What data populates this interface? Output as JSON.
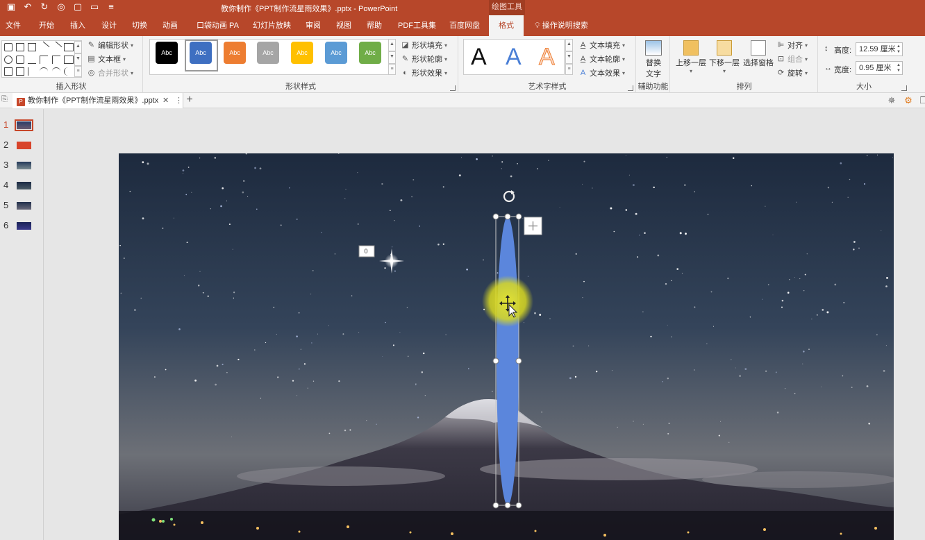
{
  "titlebar": {
    "title": "教你制作《PPT制作流星雨效果》.pptx  -  PowerPoint",
    "context_group": "绘图工具"
  },
  "tabs": [
    {
      "label": "文件"
    },
    {
      "label": "开始"
    },
    {
      "label": "插入"
    },
    {
      "label": "设计"
    },
    {
      "label": "切换"
    },
    {
      "label": "动画"
    },
    {
      "label": "口袋动画 PA"
    },
    {
      "label": "幻灯片放映"
    },
    {
      "label": "审阅"
    },
    {
      "label": "视图"
    },
    {
      "label": "帮助"
    },
    {
      "label": "PDF工具集"
    },
    {
      "label": "百度网盘"
    },
    {
      "label": "格式"
    }
  ],
  "tell_me": "操作说明搜索",
  "ribbon": {
    "insert_shapes": {
      "label": "插入形状",
      "edit_shape": "编辑形状",
      "text_box": "文本框",
      "merge_shapes": "合并形状"
    },
    "shape_styles": {
      "label": "形状样式",
      "sample_text": "Abc",
      "swatches": [
        "#000000",
        "#3e6fc1",
        "#ed7d31",
        "#a5a5a5",
        "#ffc000",
        "#5b9bd5",
        "#70ad47"
      ],
      "fill": "形状填充",
      "outline": "形状轮廓",
      "effects": "形状效果"
    },
    "wordart": {
      "label": "艺术字样式",
      "letter": "A",
      "text_fill": "文本填充",
      "text_outline": "文本轮廓",
      "text_effects": "文本效果"
    },
    "accessibility": {
      "label": "辅助功能",
      "alt_text_line1": "替换",
      "alt_text_line2": "文字"
    },
    "arrange": {
      "label": "排列",
      "bring_forward": "上移一层",
      "send_backward": "下移一层",
      "selection_pane": "选择窗格",
      "align": "对齐",
      "group": "组合",
      "rotate": "旋转"
    },
    "size": {
      "label": "大小",
      "height_label": "高度:",
      "height_value": "12.59 厘米",
      "width_label": "宽度:",
      "width_value": "0.95 厘米"
    }
  },
  "document_tab": {
    "name": "教你制作《PPT制作流星雨效果》.pptx",
    "close": "✕",
    "more": "⋮",
    "new_tab": "+"
  },
  "slides": [
    {
      "number": "1",
      "active": true
    },
    {
      "number": "2",
      "active": false
    },
    {
      "number": "3",
      "active": false
    },
    {
      "number": "4",
      "active": false
    },
    {
      "number": "5",
      "active": false
    },
    {
      "number": "6",
      "active": false
    }
  ],
  "canvas": {
    "animation_tag": "0",
    "shape_color": "#5b86dc",
    "highlight_color": "#e8e62a"
  }
}
